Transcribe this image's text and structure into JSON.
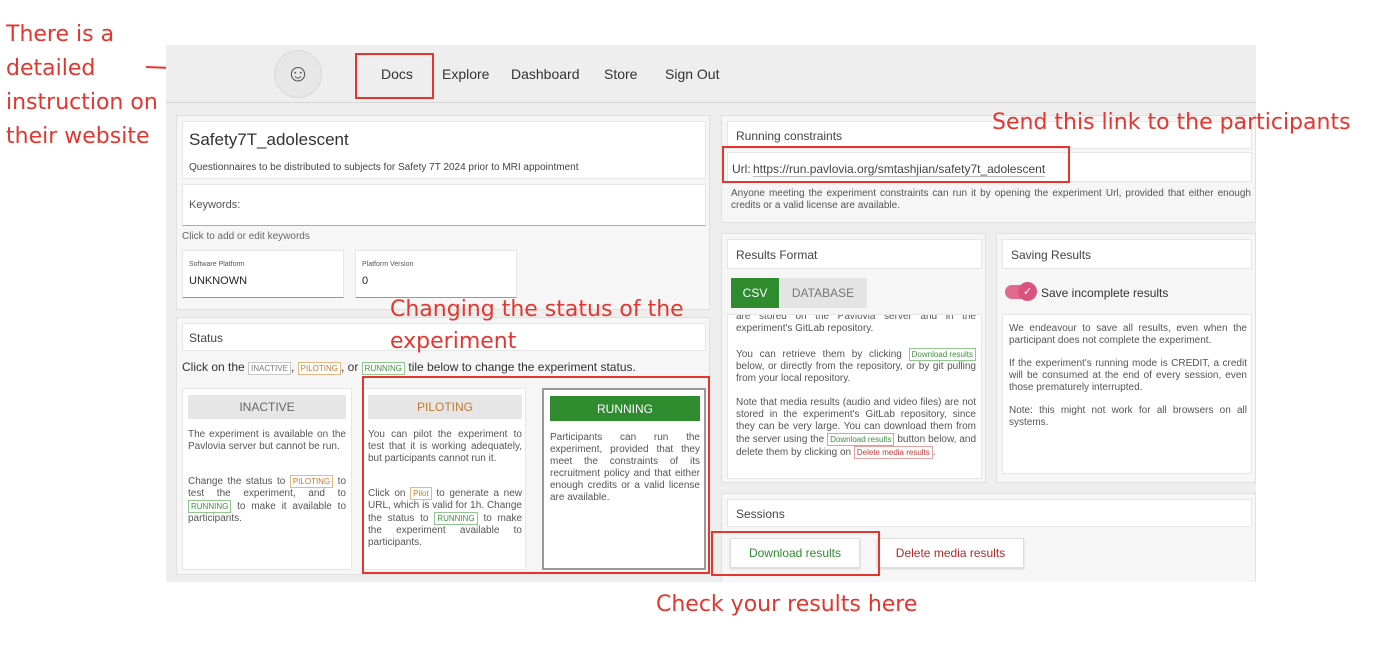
{
  "annotations": {
    "website": "There is a detailed instruction on their website",
    "link": "Send this link to the participants",
    "status": "Changing the status of the experiment",
    "results": "Check your results here"
  },
  "nav": {
    "logo_icon": "pavlovia-logo-icon",
    "items": [
      "Docs",
      "Explore",
      "Dashboard",
      "Store",
      "Sign Out"
    ]
  },
  "project": {
    "title": "Safety7T_adolescent",
    "description": "Questionnaires to be distributed to subjects for Safety 7T 2024 prior to MRI appointment",
    "keywords_label": "Keywords:",
    "keywords_hint": "Click to add or edit keywords",
    "platform_label": "Software Platform",
    "platform_value": "UNKNOWN",
    "version_label": "Platform Version",
    "version_value": "0"
  },
  "status": {
    "heading": "Status",
    "instruction_pre": "Click on the",
    "instruction_tag1": "INACTIVE",
    "instruction_sep1": ",",
    "instruction_tag2": "PILOTING",
    "instruction_sep2": ", or",
    "instruction_tag3": "RUNNING",
    "instruction_post": "tile below to change the experiment status.",
    "inactive": {
      "label": "INACTIVE",
      "text1": "The experiment is available on the Pavlovia server but cannot be run.",
      "text2_pre": "Change the status to",
      "text2_tag1": "PILOTING",
      "text2_mid": "to test the experiment, and to",
      "text2_tag2": "RUNNING",
      "text2_post": "to make it available to participants."
    },
    "piloting": {
      "label": "PILOTING",
      "text1": "You can pilot the experiment to test that it is working adequately, but participants cannot run it.",
      "text2_pre": "Click on",
      "text2_tag1": "Pilot",
      "text2_mid": "to generate a new URL, which is valid for 1h. Change the status to",
      "text2_tag2": "RUNNING",
      "text2_post": "to make the experiment available to participants."
    },
    "running": {
      "label": "RUNNING",
      "text": "Participants can run the experiment, provided that they meet the constraints of its recruitment policy and that either enough credits or a valid license are available."
    }
  },
  "constraints": {
    "heading": "Running constraints",
    "url_label": "Url:",
    "url": "https://run.pavlovia.org/smtashjian/safety7t_adolescent",
    "note": "Anyone meeting the experiment constraints can run it by opening the experiment Url, provided that either enough credits or a valid license are available."
  },
  "results_format": {
    "heading": "Results Format",
    "tab_csv": "CSV",
    "tab_database": "DATABASE",
    "text_top": "are stored on the Pavlovia server and in the experiment's GitLab repository.",
    "text2_pre": "You can retrieve them by clicking",
    "text2_tag": "Download results",
    "text2_post": "below, or directly from the repository, or by git pulling from your local repository.",
    "text3_pre": "Note that media results (audio and video files) are not stored in the experiment's GitLab repository, since they can be very large. You can download them from the server using the",
    "text3_tag": "Download results",
    "text3_mid": "button below, and delete them by clicking on",
    "text3_tag2": "Delete media results",
    "text3_post": "."
  },
  "saving": {
    "heading": "Saving Results",
    "toggle_label": "Save incomplete results",
    "toggle_on": true,
    "p1": "We endeavour to save all results, even when the participant does not complete the experiment.",
    "p2": "If the experiment's running mode is CREDIT, a credit will be consumed at the end of every session, even those prematurely interrupted.",
    "p3": "Note: this might not work for all browsers on all systems."
  },
  "sessions": {
    "heading": "Sessions",
    "download_button": "Download results",
    "delete_button": "Delete media results"
  },
  "colors": {
    "annotation_red": "#e5352e",
    "running_green": "#2e8b2e",
    "piloting_orange": "#c57a2f",
    "toggle_pink": "#e06a8e"
  }
}
